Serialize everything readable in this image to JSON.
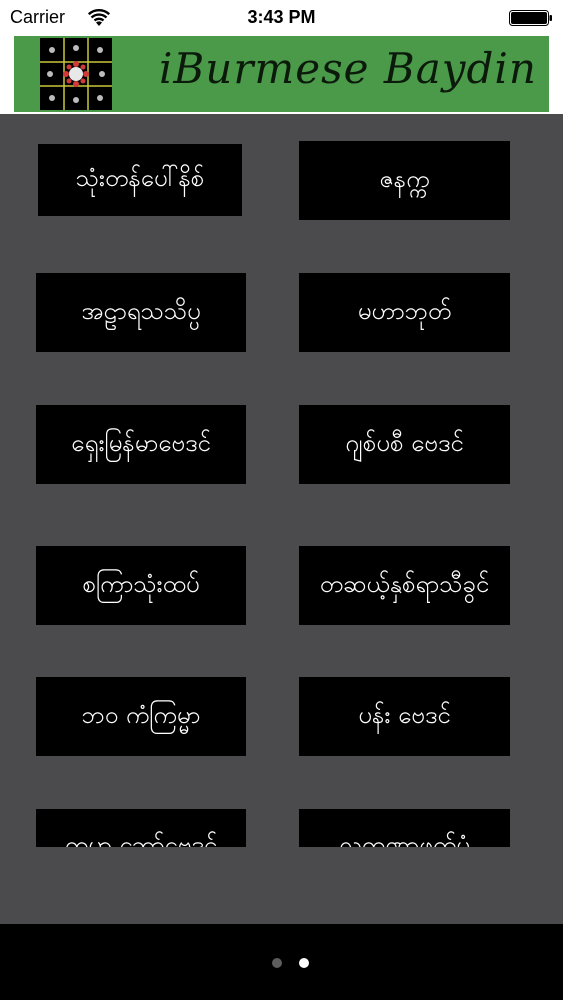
{
  "status_bar": {
    "carrier": "Carrier",
    "time": "3:43 PM",
    "icons": [
      "wifi-icon",
      "battery-icon"
    ]
  },
  "header": {
    "title": "iBurmese Baydin",
    "logo_icon": "astrology-grid-logo",
    "banner_color": "#4a9a4a"
  },
  "menu": {
    "items": [
      {
        "label": "သုံးတန်ပေါ်နိစ်"
      },
      {
        "label": "ဇနက္က"
      },
      {
        "label": "အဠာရသသိပ္ပ"
      },
      {
        "label": "မဟာဘုတ်"
      },
      {
        "label": "ရှေးမြန်မာဗေဒင်"
      },
      {
        "label": "ဂျစ်ပစီ ဗေဒင်"
      },
      {
        "label": "စကြာသုံးထပ်"
      },
      {
        "label": "တဆယ့်နှစ်ရာသီခွင်"
      },
      {
        "label": "ဘ၀ ကံကြမ္မာ"
      },
      {
        "label": "ပန်း ဗေဒင်"
      },
      {
        "label": "ကမ္ဘာ ဆော်ဗေဒင်"
      },
      {
        "label": "လက္ခဏာဖတ်ပုံ"
      }
    ]
  },
  "pager": {
    "page_count": 2,
    "current_page": 2
  },
  "colors": {
    "background": "#4b4b4d",
    "button": "#000000",
    "button_text": "#ffffff"
  }
}
